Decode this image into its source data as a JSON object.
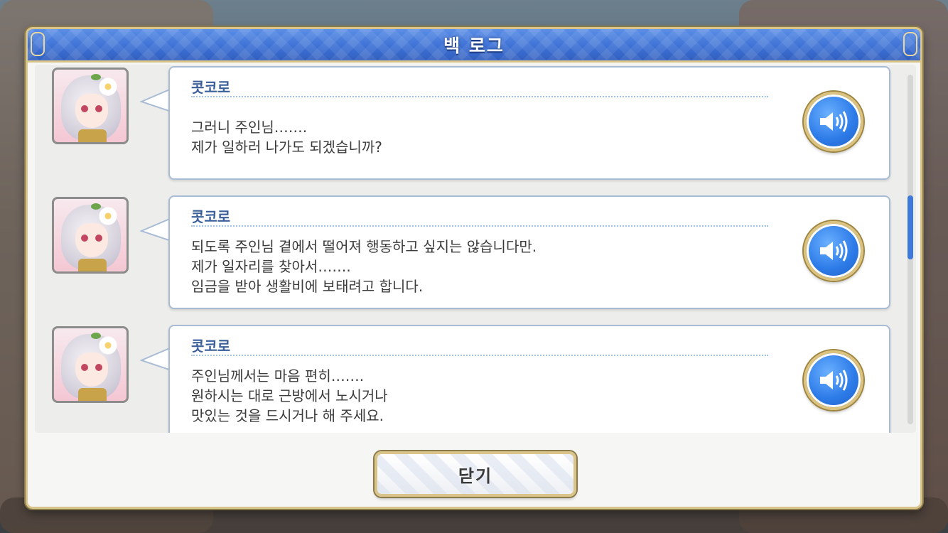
{
  "dialog": {
    "title": "백 로그",
    "close_label": "닫기"
  },
  "entries": [
    {
      "speaker": "콧코로",
      "lines": [
        "그러니 주인님…….",
        "제가 일하러 나가도 되겠습니까?"
      ]
    },
    {
      "speaker": "콧코로",
      "lines": [
        "되도록 주인님 곁에서 떨어져 행동하고 싶지는 않습니다만.",
        "제가 일자리를 찾아서…….",
        "임금을 받아 생활비에 보태려고 합니다."
      ]
    },
    {
      "speaker": "콧코로",
      "lines": [
        "주인님께서는 마음 편히…….",
        "원하시는 대로 근방에서 노시거나",
        "맛있는 것을 드시거나 해 주세요."
      ]
    }
  ],
  "icons": {
    "voice": "speaker-icon",
    "portrait": "character-portrait"
  },
  "colors": {
    "title_bar": "#3c6fd3",
    "speaker_name": "#3a5f9a",
    "frame_gold": "#d9c48a",
    "scroll_thumb": "#3e78d8"
  }
}
